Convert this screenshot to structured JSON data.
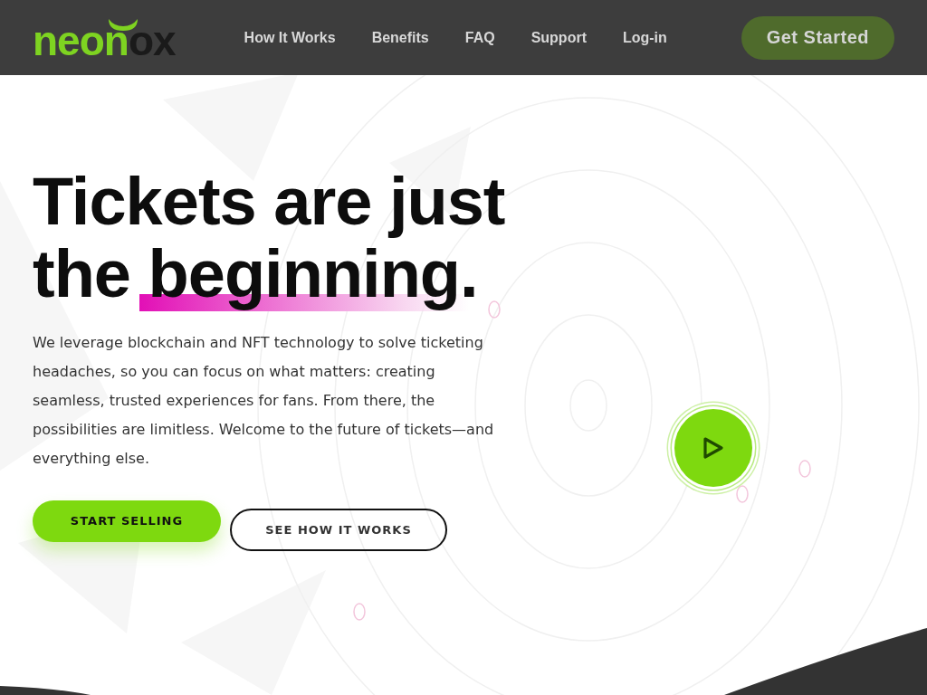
{
  "header": {
    "logo": {
      "lead": "neon",
      "tail": "ox"
    },
    "nav": [
      {
        "label": "How It Works"
      },
      {
        "label": "Benefits"
      },
      {
        "label": "FAQ"
      },
      {
        "label": "Support"
      },
      {
        "label": "Log-in"
      }
    ],
    "cta": "Get Started"
  },
  "hero": {
    "heading_start": "Tickets are just the",
    "heading_highlight": "beginning",
    "heading_end": ".",
    "body": "We leverage blockchain and NFT technology to solve ticketing headaches, so you can focus on what matters: creating seamless, trusted experiences for fans. From there, the possibilities are limitless. Welcome to the future of tickets—and everything else.",
    "buttons": [
      {
        "label": "START SELLING",
        "kind": "primary"
      },
      {
        "label": "SEE HOW IT WORKS",
        "kind": "outline"
      }
    ]
  }
}
